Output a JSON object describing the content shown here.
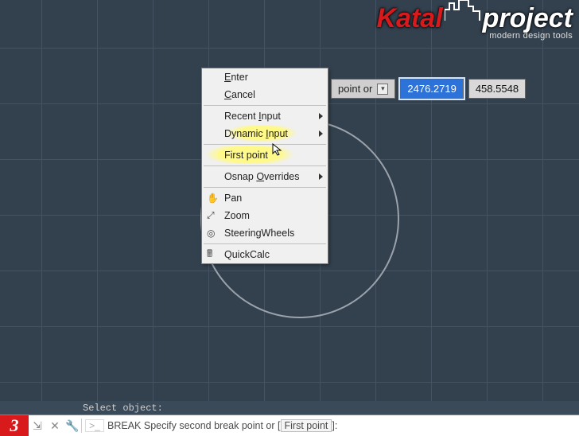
{
  "logo": {
    "name": "Katal",
    "name2": "project",
    "tagline": "modern design tools"
  },
  "coord": {
    "hint_fragment": "point or",
    "x": "2476.2719",
    "y": "458.5548"
  },
  "context_menu": {
    "enter": "Enter",
    "cancel": "Cancel",
    "recent_input": "Recent Input",
    "dynamic_input": "Dynamic Input",
    "first_point": "First point",
    "osnap_overrides": "Osnap Overrides",
    "pan": "Pan",
    "zoom": "Zoom",
    "steering_wheels": "SteeringWheels",
    "quickcalc": "QuickCalc",
    "underline": {
      "enter": "E",
      "cancel": "C",
      "recent": "I",
      "dynamic": "I",
      "osnap": "O"
    }
  },
  "command": {
    "history": "Select object:",
    "cmd_name": "BREAK",
    "prompt_pre": " Specify second break point or [",
    "option": "First point",
    "prompt_post": "]:",
    "step": "3"
  }
}
